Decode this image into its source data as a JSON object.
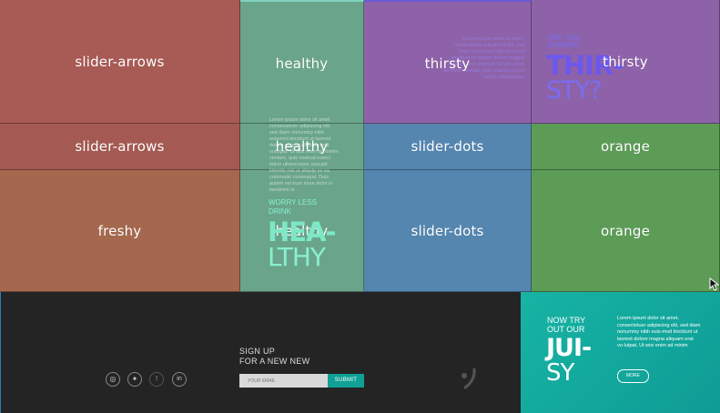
{
  "grid": {
    "row1": [
      "slider-arrows",
      "healthy",
      "thirsty",
      "thirsty"
    ],
    "row2": [
      "slider-arrows",
      "healthy",
      "slider-dots",
      "orange"
    ],
    "row3": [
      "freshy",
      "healthy",
      "slider-dots",
      "orange"
    ]
  },
  "healthy_panel": {
    "body": "Lorem ipsum dolor sit amet consectetuer adipiscing elit sed diam nonummy nibh euismod tincidunt ut laoreet dolore magna aliquam erat volutpat. Ut wisi enim ad minim veniam, quis nostrud exerci tation ullamcorper suscipit lobortis nisl ut aliquip ex ea commodo consequat. Duis autem vel eum iriure dolor in hendrerit in",
    "kicker_1": "WORRY LESS",
    "kicker_2": "DRINK",
    "big_1": "HEA-",
    "big_2": "LTHY"
  },
  "thirsty_panel": {
    "body": "Lorem ipsum dolor sit amet, consectetuer adipiscing elit, sed diam nonummy nibh euismod tincidunt ut laoreet dolore magna aliquam erat volutpat. Ut wisi enim ad minim veniam quis nostrud exerci tation ullamcorper",
    "kicker_1": "ARE YOU",
    "kicker_2": "SUMMER",
    "big_1": "THIR-",
    "big_2": "STY?"
  },
  "footer": {
    "signup_1": "SIGN UP",
    "signup_2": "FOR A NEW NEW",
    "email_placeholder": "YOUR EMAIL",
    "submit_label": "SUBMIT",
    "social": [
      "◎",
      "✦",
      "f",
      "in"
    ]
  },
  "promo": {
    "kicker_1": "NOW TRY",
    "kicker_2": "OUT OUR",
    "big_1": "JUI-",
    "big_2": "SY",
    "body": "Lorem ipsum dolor sit amet, consectetuer adipiscing elit, sed diam nonummy nibh euis-mod tincidunt ut laoreet dolore magna aliquam erat vo-lutpat. Ut wisi enim ad minim",
    "more_label": "MORE"
  },
  "colors": {
    "red": "#a85a54",
    "teal": "#6aa58b",
    "purple": "#8e62a8",
    "blue": "#5486b0",
    "green": "#5c9c57",
    "brown": "#a5684f",
    "accent_teal": "#17b4a4"
  }
}
